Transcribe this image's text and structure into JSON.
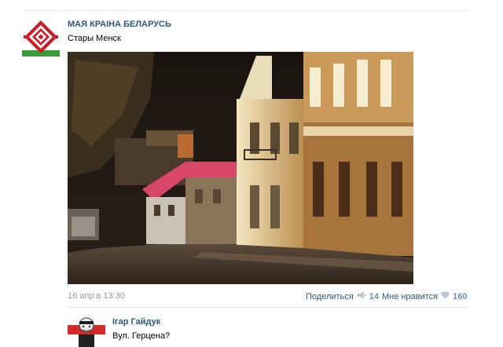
{
  "post": {
    "group_name": "МАЯ КРАІНА БЕЛАРУСЬ",
    "text": "Стары Менск",
    "date": "16 апр в 13:30",
    "share_label": "Поделиться",
    "share_count": "14",
    "like_label": "Мне нравится",
    "like_count": "160"
  },
  "comment": {
    "author": "Ігар Гайдук",
    "text": "Вул. Герцена?"
  },
  "icons": {
    "avatar": "ornament-emblem-icon",
    "share": "megaphone-icon",
    "like": "heart-icon"
  },
  "colors": {
    "link": "#2b587a",
    "muted": "#999999",
    "count": "#6d8fb3",
    "flag_red": "#d42a2a"
  }
}
